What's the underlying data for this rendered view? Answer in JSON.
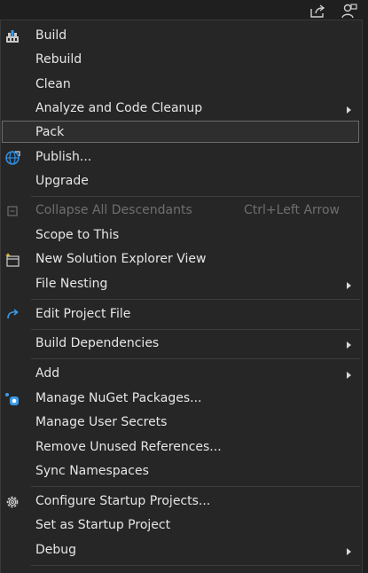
{
  "menu": {
    "items": [
      {
        "label": "Build",
        "icon": "build-icon"
      },
      {
        "label": "Rebuild"
      },
      {
        "label": "Clean"
      },
      {
        "label": "Analyze and Code Cleanup",
        "submenu": true
      },
      {
        "label": "Pack",
        "highlighted": true
      },
      {
        "label": "Publish...",
        "icon": "globe-publish-icon"
      },
      {
        "label": "Upgrade"
      },
      {
        "label": "Collapse All Descendants",
        "shortcut": "Ctrl+Left Arrow",
        "disabled": true,
        "icon": "collapse-icon"
      },
      {
        "label": "Scope to This"
      },
      {
        "label": "New Solution Explorer View",
        "icon": "new-view-icon"
      },
      {
        "label": "File Nesting",
        "submenu": true
      },
      {
        "label": "Edit Project File",
        "icon": "edit-redo-arrow-icon"
      },
      {
        "label": "Build Dependencies",
        "submenu": true
      },
      {
        "label": "Add",
        "submenu": true
      },
      {
        "label": "Manage NuGet Packages...",
        "icon": "nuget-icon"
      },
      {
        "label": "Manage User Secrets"
      },
      {
        "label": "Remove Unused References..."
      },
      {
        "label": "Sync Namespaces"
      },
      {
        "label": "Configure Startup Projects...",
        "icon": "gear-icon"
      },
      {
        "label": "Set as Startup Project"
      },
      {
        "label": "Debug",
        "submenu": true
      }
    ]
  },
  "topbar": {
    "icons": [
      "share-icon",
      "live-share-user-icon"
    ]
  },
  "colors": {
    "menu_bg": "#262626",
    "text": "#e6e6e6",
    "disabled_text": "#6e6e6e",
    "nuget_blue": "#3b9be8",
    "globe_blue": "#2f8fe3"
  }
}
